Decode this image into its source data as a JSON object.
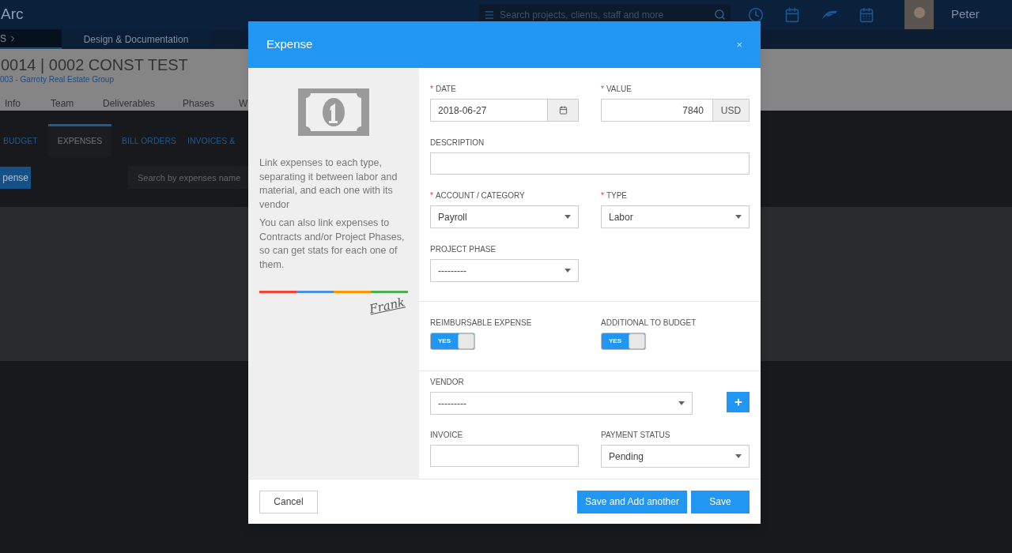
{
  "top_bar": {
    "app_name": "Arc",
    "search": {
      "placeholder": "Search projects, clients, staff and more"
    },
    "user": {
      "name": "Peter"
    }
  },
  "breadcrumb": [
    "S",
    "Design & Documentation"
  ],
  "project": {
    "title": "0014 | 0002 CONST TEST",
    "client": "003 - Garroty Real Estate Group",
    "tabs": [
      "Info",
      "Team",
      "Deliverables",
      "Phases",
      "W"
    ]
  },
  "subtabs": [
    {
      "label": "BUDGET",
      "selected": false
    },
    {
      "label": "EXPENSES",
      "selected": true
    },
    {
      "label": "BILL ORDERS",
      "selected": false
    },
    {
      "label": "INVOICES &",
      "selected": false
    }
  ],
  "toolbar": {
    "add_button": "pense",
    "search": {
      "placeholder": "Search by expenses name"
    }
  },
  "modal": {
    "title": "Expense",
    "close": "×",
    "info": {
      "paragraphs": [
        "Link expenses to each type, separating it between labor and material, and each one with its vendor",
        "You can also link expenses to Contracts and/or Project Phases, so can get stats for each one of them."
      ],
      "signature": "Frank"
    },
    "date": {
      "label": "DATE",
      "mark": "*",
      "value": "2018-06-27"
    },
    "value": {
      "label": "VALUE",
      "mark": "*",
      "value": "7840",
      "currency": "USD"
    },
    "description": {
      "label": "DESCRIPTION"
    },
    "account": {
      "label": "ACCOUNT / CATEGORY",
      "mark": "*",
      "value": "Payroll"
    },
    "type": {
      "label": "TYPE",
      "mark": "*",
      "value": "Labor"
    },
    "project_phase": {
      "label": "PROJECT PHASE",
      "value": "---------"
    },
    "reimbursable": {
      "label": "REIMBURSABLE EXPENSE",
      "on": true,
      "text": "YES"
    },
    "additional_to_budget": {
      "label": "ADDITIONAL TO BUDGET",
      "on": true,
      "text": "YES"
    },
    "vendor": {
      "label": "VENDOR",
      "value": "---------"
    },
    "invoice": {
      "label": "INVOICE"
    },
    "payment_status": {
      "label": "PAYMENT STATUS",
      "value": "Pending"
    },
    "buttons": {
      "cancel": "Cancel",
      "save_another": "Save and Add another",
      "save": "Save"
    }
  }
}
